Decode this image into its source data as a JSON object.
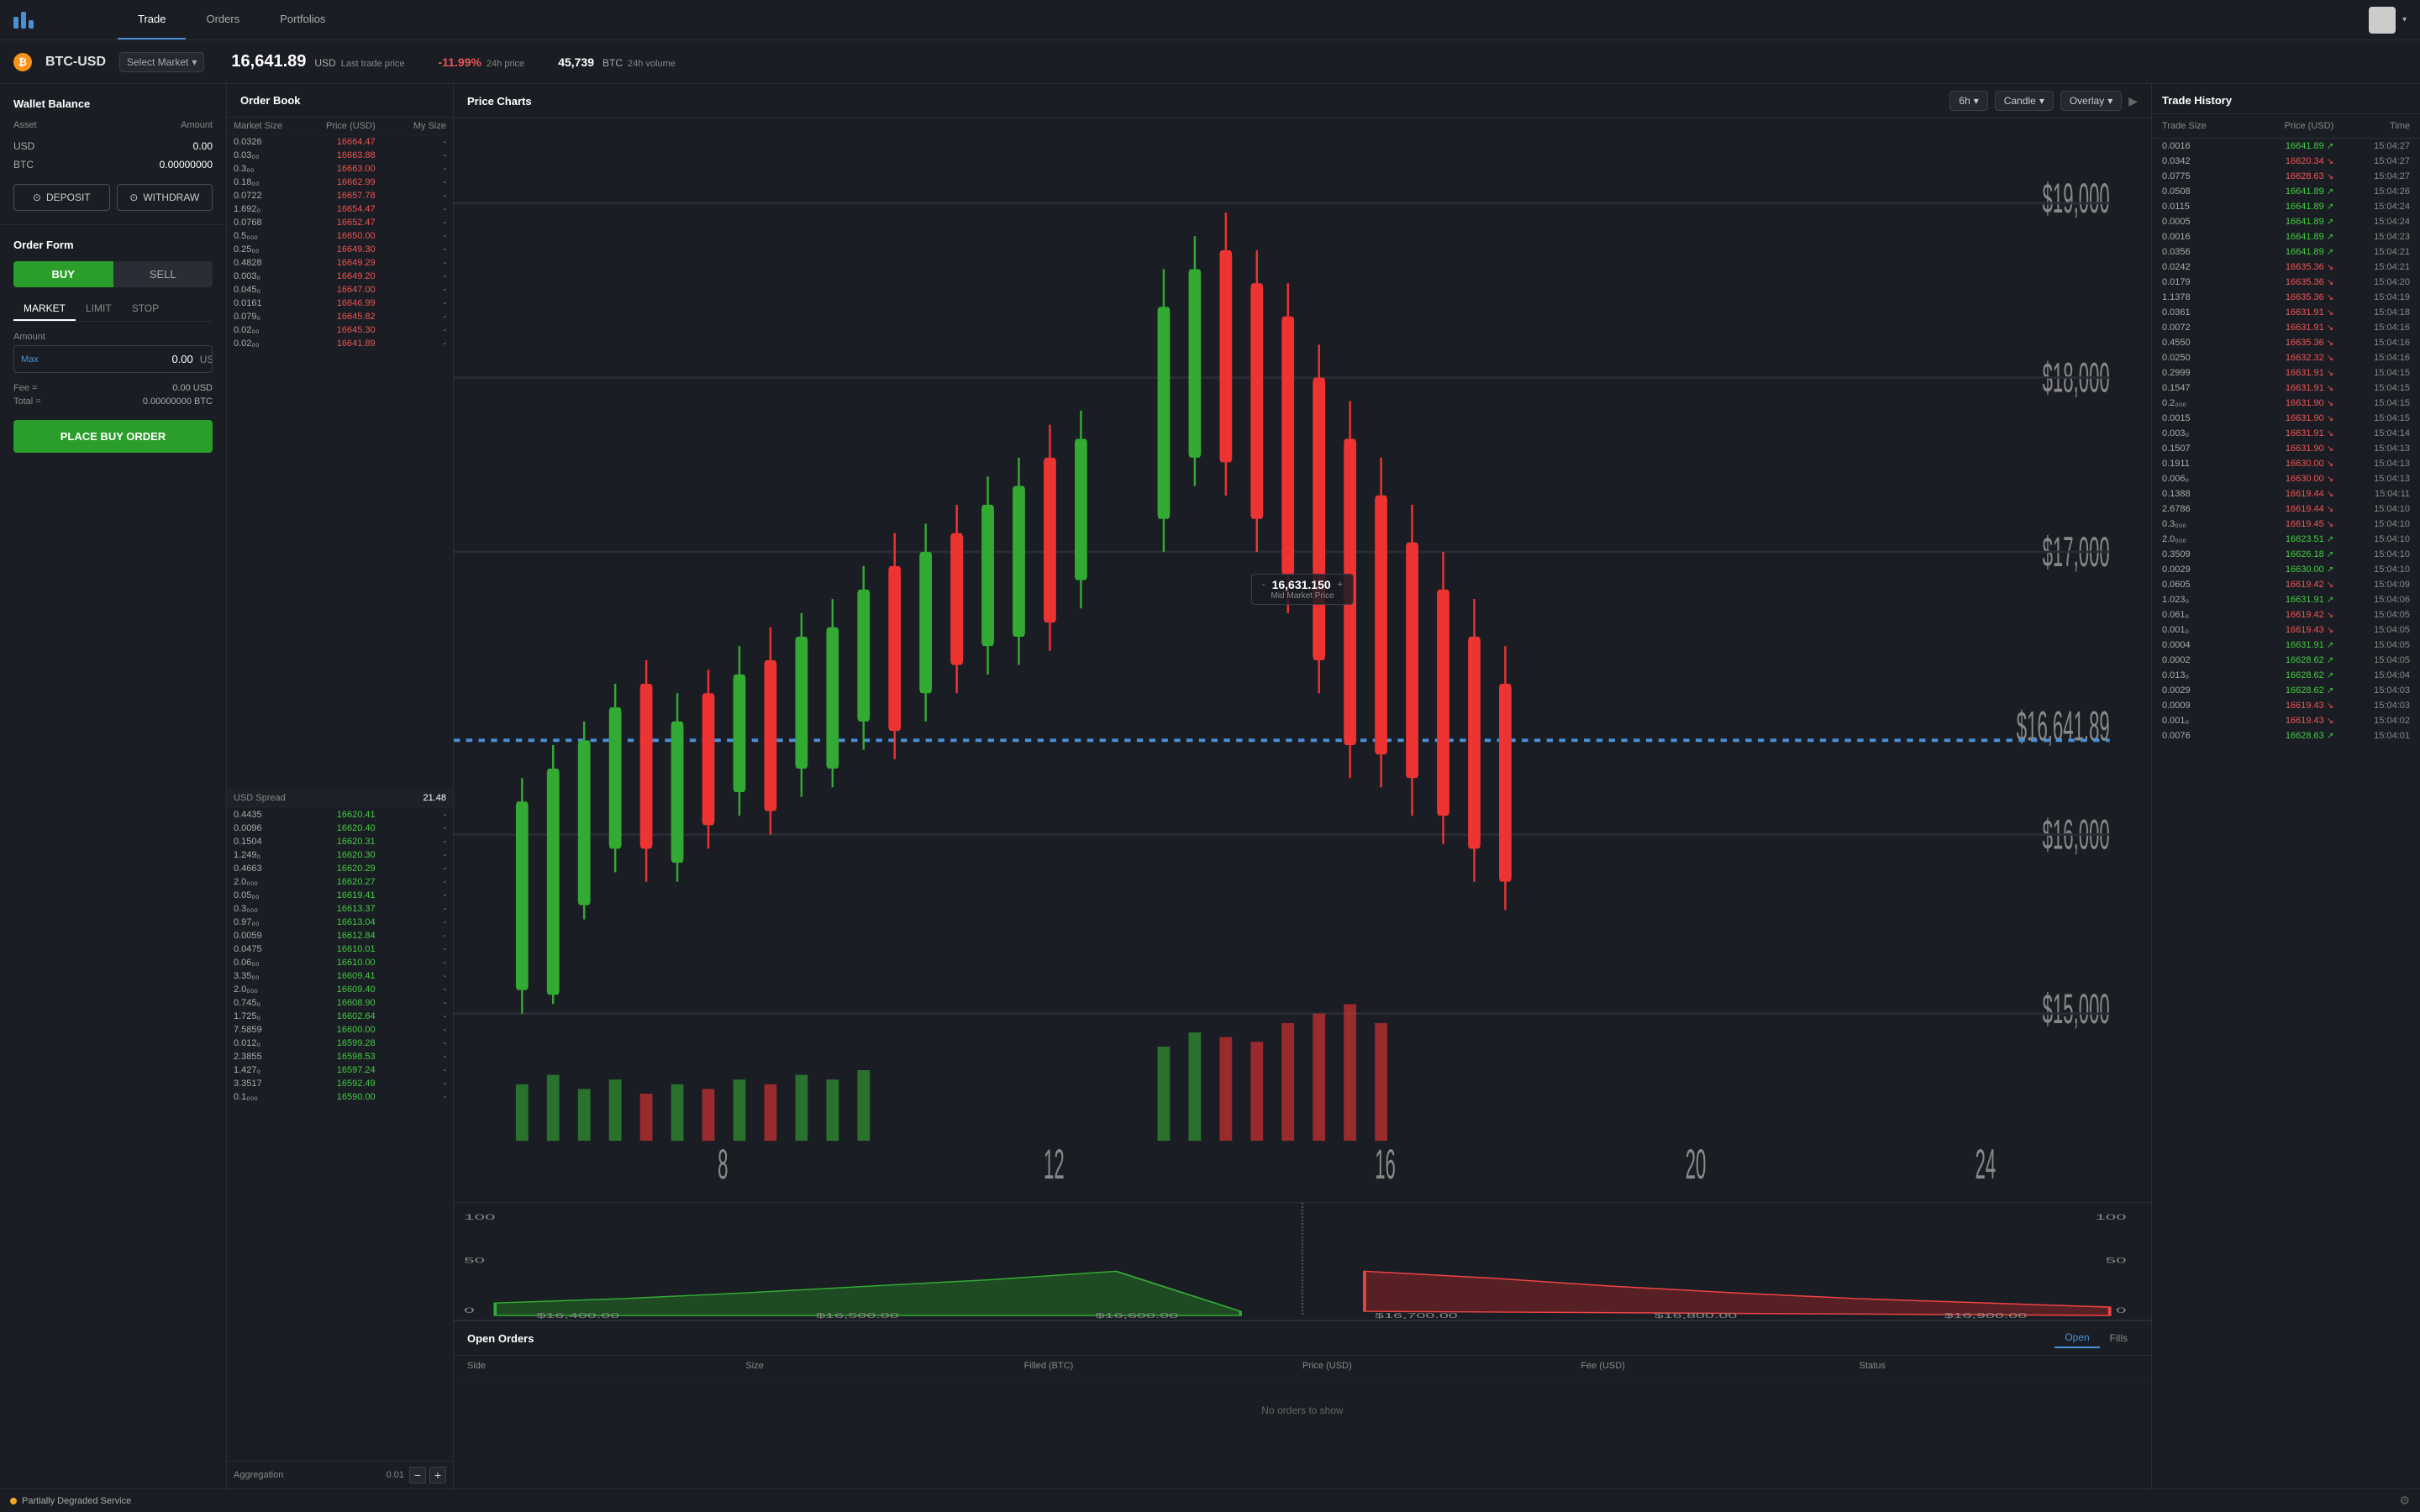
{
  "app": {
    "logo_alt": "Coinbase Pro",
    "nav": {
      "trade_label": "Trade",
      "orders_label": "Orders",
      "portfolios_label": "Portfolios"
    }
  },
  "ticker": {
    "symbol": "BTC-USD",
    "btc_icon": "₿",
    "select_market": "Select Market",
    "last_price": "16,641.89",
    "last_price_currency": "USD",
    "last_price_label": "Last trade price",
    "change_24h": "-11.99%",
    "change_24h_label": "24h price",
    "volume_24h": "45,739",
    "volume_currency": "BTC",
    "volume_label": "24h volume"
  },
  "wallet": {
    "title": "Wallet Balance",
    "asset_label": "Asset",
    "amount_label": "Amount",
    "usd_asset": "USD",
    "usd_amount": "0.00",
    "btc_asset": "BTC",
    "btc_amount": "0.00000000",
    "deposit_label": "DEPOSIT",
    "withdraw_label": "WITHDRAW"
  },
  "order_form": {
    "title": "Order Form",
    "buy_label": "BUY",
    "sell_label": "SELL",
    "market_tab": "MARKET",
    "limit_tab": "LIMIT",
    "stop_tab": "STOP",
    "amount_label": "Amount",
    "max_label": "Max",
    "amount_value": "0.00",
    "amount_currency": "USD",
    "fee_label": "Fee =",
    "fee_value": "0.00 USD",
    "total_label": "Total =",
    "total_value": "0.00000000 BTC",
    "place_order_label": "PLACE BUY ORDER"
  },
  "order_book": {
    "title": "Order Book",
    "col_market_size": "Market Size",
    "col_price": "Price (USD)",
    "col_my_size": "My Size",
    "sell_orders": [
      {
        "size": "0.0326",
        "price": "16664.47",
        "my_size": "-"
      },
      {
        "size": "0.03₀₀",
        "price": "16663.88",
        "my_size": "-"
      },
      {
        "size": "0.3₀₀",
        "price": "16663.00",
        "my_size": "-"
      },
      {
        "size": "0.18₀₀",
        "price": "16662.99",
        "my_size": "-"
      },
      {
        "size": "0.0722",
        "price": "16657.78",
        "my_size": "-"
      },
      {
        "size": "1.692₀",
        "price": "16654.47",
        "my_size": "-"
      },
      {
        "size": "0.0768",
        "price": "16652.47",
        "my_size": "-"
      },
      {
        "size": "0.5₀₀₀",
        "price": "16650.00",
        "my_size": "-"
      },
      {
        "size": "0.25₀₀",
        "price": "16649.30",
        "my_size": "-"
      },
      {
        "size": "0.4828",
        "price": "16649.29",
        "my_size": "-"
      },
      {
        "size": "0.003₀",
        "price": "16649.20",
        "my_size": "-"
      },
      {
        "size": "0.045₀",
        "price": "16647.00",
        "my_size": "-"
      },
      {
        "size": "0.0161",
        "price": "16646.99",
        "my_size": "-"
      },
      {
        "size": "0.079₀",
        "price": "16645.82",
        "my_size": "-"
      },
      {
        "size": "0.02₀₀",
        "price": "16645.30",
        "my_size": "-"
      },
      {
        "size": "0.02₀₀",
        "price": "16641.89",
        "my_size": "-"
      }
    ],
    "spread_label": "USD Spread",
    "spread_value": "21.48",
    "buy_orders": [
      {
        "size": "0.4435",
        "price": "16620.41",
        "my_size": "-"
      },
      {
        "size": "0.0096",
        "price": "16620.40",
        "my_size": "-"
      },
      {
        "size": "0.1504",
        "price": "16620.31",
        "my_size": "-"
      },
      {
        "size": "1.249₀",
        "price": "16620.30",
        "my_size": "-"
      },
      {
        "size": "0.4663",
        "price": "16620.29",
        "my_size": "-"
      },
      {
        "size": "2.0₀₀₀",
        "price": "16620.27",
        "my_size": "-"
      },
      {
        "size": "0.05₀₀",
        "price": "16619.41",
        "my_size": "-"
      },
      {
        "size": "0.3₀₀₀",
        "price": "16613.37",
        "my_size": "-"
      },
      {
        "size": "0.97₀₀",
        "price": "16613.04",
        "my_size": "-"
      },
      {
        "size": "0.0059",
        "price": "16612.84",
        "my_size": "-"
      },
      {
        "size": "0.0475",
        "price": "16610.01",
        "my_size": "-"
      },
      {
        "size": "0.06₀₀",
        "price": "16610.00",
        "my_size": "-"
      },
      {
        "size": "3.35₀₀",
        "price": "16609.41",
        "my_size": "-"
      },
      {
        "size": "2.0₀₀₀",
        "price": "16609.40",
        "my_size": "-"
      },
      {
        "size": "0.745₀",
        "price": "16608.90",
        "my_size": "-"
      },
      {
        "size": "1.725₀",
        "price": "16602.64",
        "my_size": "-"
      },
      {
        "size": "7.5859",
        "price": "16600.00",
        "my_size": "-"
      },
      {
        "size": "0.012₀",
        "price": "16599.28",
        "my_size": "-"
      },
      {
        "size": "2.3855",
        "price": "16598.53",
        "my_size": "-"
      },
      {
        "size": "1.427₀",
        "price": "16597.24",
        "my_size": "-"
      },
      {
        "size": "3.3517",
        "price": "16592.49",
        "my_size": "-"
      },
      {
        "size": "0.1₀₀₀",
        "price": "16590.00",
        "my_size": "-"
      }
    ],
    "aggregation_label": "Aggregation",
    "aggregation_value": "0.01"
  },
  "price_chart": {
    "title": "Price Charts",
    "timeframe": "6h",
    "chart_type": "Candle",
    "overlay": "Overlay",
    "mid_market_price": "16,631.150",
    "mid_market_label": "Mid Market Price",
    "price_labels": [
      "$15,000",
      "$16,000",
      "$17,000",
      "$18,000",
      "$19,000"
    ],
    "time_labels": [
      "8",
      "12",
      "16",
      "20",
      "24"
    ],
    "depth_minus": "-",
    "depth_plus": "+",
    "depth_left_label": "100",
    "depth_right_label": "100",
    "depth_mid_label": "0",
    "depth_price_labels": [
      "$16,400.00",
      "$16,500.00",
      "$16,600.00",
      "$16,700.00",
      "$16,800.00",
      "$16,900.00"
    ]
  },
  "open_orders": {
    "title": "Open Orders",
    "open_tab": "Open",
    "fills_tab": "Fills",
    "col_side": "Side",
    "col_size": "Size",
    "col_filled": "Filled (BTC)",
    "col_price": "Price (USD)",
    "col_fee": "Fee (USD)",
    "col_status": "Status",
    "empty_message": "No orders to show"
  },
  "trade_history": {
    "title": "Trade History",
    "col_trade_size": "Trade Size",
    "col_price": "Price (USD)",
    "col_time": "Time",
    "trades": [
      {
        "size": "0.0016",
        "price": "16641.89",
        "direction": "up",
        "time": "15:04:27"
      },
      {
        "size": "0.0342",
        "price": "16620.34",
        "direction": "down",
        "time": "15:04:27"
      },
      {
        "size": "0.0775",
        "price": "16628.63",
        "direction": "down",
        "time": "15:04:27"
      },
      {
        "size": "0.0508",
        "price": "16641.89",
        "direction": "up",
        "time": "15:04:26"
      },
      {
        "size": "0.0115",
        "price": "16641.89",
        "direction": "up",
        "time": "15:04:24"
      },
      {
        "size": "0.0005",
        "price": "16641.89",
        "direction": "up",
        "time": "15:04:24"
      },
      {
        "size": "0.0016",
        "price": "16641.89",
        "direction": "up",
        "time": "15:04:23"
      },
      {
        "size": "0.0356",
        "price": "16641.89",
        "direction": "up",
        "time": "15:04:21"
      },
      {
        "size": "0.0242",
        "price": "16635.36",
        "direction": "down",
        "time": "15:04:21"
      },
      {
        "size": "0.0179",
        "price": "16635.36",
        "direction": "down",
        "time": "15:04:20"
      },
      {
        "size": "1.1378",
        "price": "16635.36",
        "direction": "down",
        "time": "15:04:19"
      },
      {
        "size": "0.0361",
        "price": "16631.91",
        "direction": "down",
        "time": "15:04:18"
      },
      {
        "size": "0.0072",
        "price": "16631.91",
        "direction": "down",
        "time": "15:04:16"
      },
      {
        "size": "0.4550",
        "price": "16635.36",
        "direction": "down",
        "time": "15:04:16"
      },
      {
        "size": "0.0250",
        "price": "16632.32",
        "direction": "down",
        "time": "15:04:16"
      },
      {
        "size": "0.2999",
        "price": "16631.91",
        "direction": "down",
        "time": "15:04:15"
      },
      {
        "size": "0.1547",
        "price": "16631.91",
        "direction": "down",
        "time": "15:04:15"
      },
      {
        "size": "0.2₀₀₀",
        "price": "16631.90",
        "direction": "down",
        "time": "15:04:15"
      },
      {
        "size": "0.0015",
        "price": "16631.90",
        "direction": "down",
        "time": "15:04:15"
      },
      {
        "size": "0.003₀",
        "price": "16631.91",
        "direction": "down",
        "time": "15:04:14"
      },
      {
        "size": "0.1507",
        "price": "16631.90",
        "direction": "down",
        "time": "15:04:13"
      },
      {
        "size": "0.1911",
        "price": "16630.00",
        "direction": "down",
        "time": "15:04:13"
      },
      {
        "size": "0.006₀",
        "price": "16630.00",
        "direction": "down",
        "time": "15:04:13"
      },
      {
        "size": "0.1388",
        "price": "16619.44",
        "direction": "down",
        "time": "15:04:11"
      },
      {
        "size": "2.6786",
        "price": "16619.44",
        "direction": "down",
        "time": "15:04:10"
      },
      {
        "size": "0.3₀₀₀",
        "price": "16619.45",
        "direction": "down",
        "time": "15:04:10"
      },
      {
        "size": "2.0₀₀₀",
        "price": "16623.51",
        "direction": "up",
        "time": "15:04:10"
      },
      {
        "size": "0.3509",
        "price": "16626.18",
        "direction": "up",
        "time": "15:04:10"
      },
      {
        "size": "0.0029",
        "price": "16630.00",
        "direction": "up",
        "time": "15:04:10"
      },
      {
        "size": "0.0605",
        "price": "16619.42",
        "direction": "down",
        "time": "15:04:09"
      },
      {
        "size": "1.023₀",
        "price": "16631.91",
        "direction": "up",
        "time": "15:04:06"
      },
      {
        "size": "0.061₀",
        "price": "16619.42",
        "direction": "down",
        "time": "15:04:05"
      },
      {
        "size": "0.001₀",
        "price": "16619.43",
        "direction": "down",
        "time": "15:04:05"
      },
      {
        "size": "0.0004",
        "price": "16631.91",
        "direction": "up",
        "time": "15:04:05"
      },
      {
        "size": "0.0002",
        "price": "16628.62",
        "direction": "up",
        "time": "15:04:05"
      },
      {
        "size": "0.013₀",
        "price": "16628.62",
        "direction": "up",
        "time": "15:04:04"
      },
      {
        "size": "0.0029",
        "price": "16628.62",
        "direction": "up",
        "time": "15:04:03"
      },
      {
        "size": "0.0009",
        "price": "16619.43",
        "direction": "down",
        "time": "15:04:03"
      },
      {
        "size": "0.001₀",
        "price": "16619.43",
        "direction": "down",
        "time": "15:04:02"
      },
      {
        "size": "0.0076",
        "price": "16628.63",
        "direction": "up",
        "time": "15:04:01"
      }
    ]
  },
  "status_bar": {
    "status_text": "Partially Degraded Service",
    "status_color": "#f5a623"
  }
}
